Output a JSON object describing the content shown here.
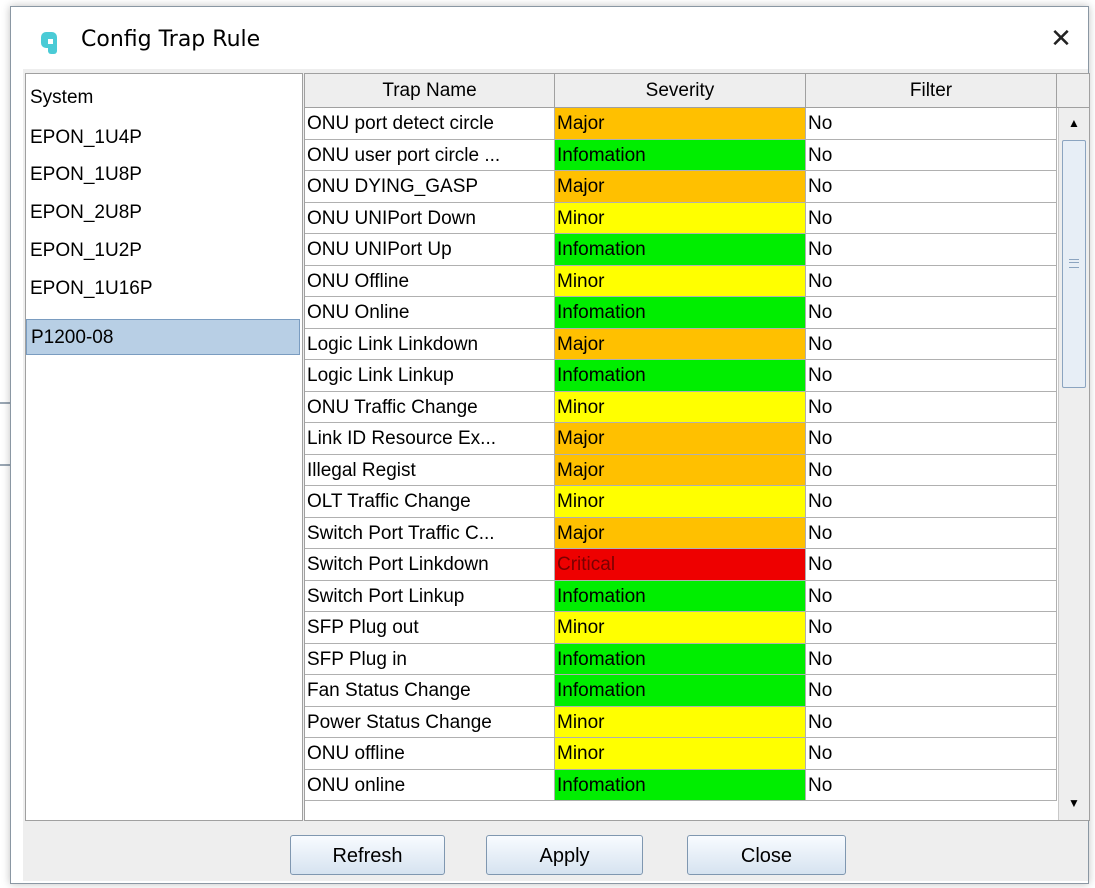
{
  "dialog": {
    "title": "Config Trap Rule",
    "close_symbol": "✕"
  },
  "colors": {
    "Major": "#ffc000",
    "Minor": "#ffff00",
    "Infomation": "#00ee00",
    "Critical": "#ee0000"
  },
  "left_list": {
    "items": [
      "System",
      "EPON_1U4P",
      "EPON_1U8P",
      "EPON_2U8P",
      "EPON_1U2P",
      "EPON_1U16P",
      "P1200-08"
    ],
    "selected": "P1200-08"
  },
  "table": {
    "headers": [
      "Trap Name",
      "Severity",
      "Filter"
    ],
    "rows": [
      {
        "name": "ONU port detect circle",
        "severity": "Major",
        "filter": "No"
      },
      {
        "name": "ONU user port circle ...",
        "severity": "Infomation",
        "filter": "No"
      },
      {
        "name": "ONU DYING_GASP",
        "severity": "Major",
        "filter": "No"
      },
      {
        "name": "ONU UNIPort Down",
        "severity": "Minor",
        "filter": "No"
      },
      {
        "name": "ONU UNIPort Up",
        "severity": "Infomation",
        "filter": "No"
      },
      {
        "name": "ONU Offline",
        "severity": "Minor",
        "filter": "No"
      },
      {
        "name": "ONU Online",
        "severity": "Infomation",
        "filter": "No"
      },
      {
        "name": "Logic Link Linkdown",
        "severity": "Major",
        "filter": "No"
      },
      {
        "name": "Logic Link Linkup",
        "severity": "Infomation",
        "filter": "No"
      },
      {
        "name": "ONU Traffic Change",
        "severity": "Minor",
        "filter": "No"
      },
      {
        "name": "Link ID Resource Ex...",
        "severity": "Major",
        "filter": "No"
      },
      {
        "name": "Illegal Regist",
        "severity": "Major",
        "filter": "No"
      },
      {
        "name": "OLT Traffic Change",
        "severity": "Minor",
        "filter": "No"
      },
      {
        "name": "Switch Port Traffic C...",
        "severity": "Major",
        "filter": "No"
      },
      {
        "name": "Switch Port Linkdown",
        "severity": "Critical",
        "filter": "No"
      },
      {
        "name": "Switch Port Linkup",
        "severity": "Infomation",
        "filter": "No"
      },
      {
        "name": "SFP Plug out",
        "severity": "Minor",
        "filter": "No"
      },
      {
        "name": "SFP Plug in",
        "severity": "Infomation",
        "filter": "No"
      },
      {
        "name": "Fan Status Change",
        "severity": "Infomation",
        "filter": "No"
      },
      {
        "name": "Power Status Change",
        "severity": "Minor",
        "filter": "No"
      },
      {
        "name": "ONU offline",
        "severity": "Minor",
        "filter": "No"
      },
      {
        "name": "ONU online",
        "severity": "Infomation",
        "filter": "No"
      }
    ]
  },
  "scrollbar": {
    "up_arrow": "▲",
    "down_arrow": "▼"
  },
  "buttons": {
    "refresh": "Refresh",
    "apply": "Apply",
    "close": "Close"
  }
}
